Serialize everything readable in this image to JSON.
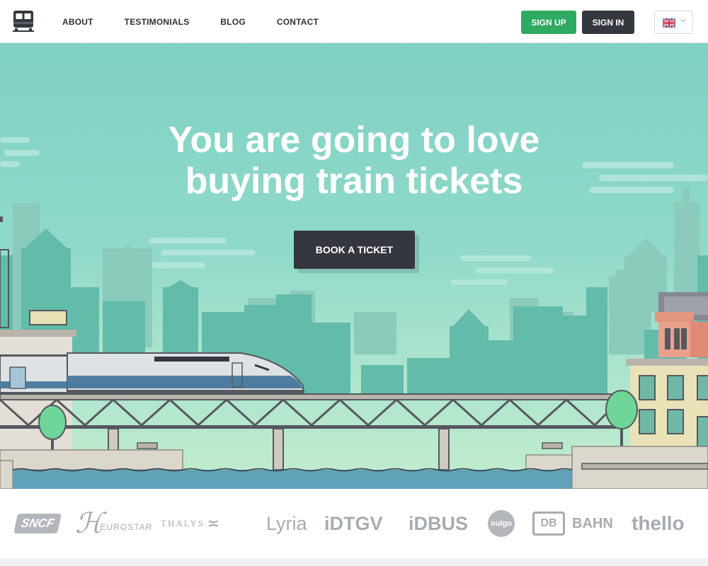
{
  "nav": {
    "links": [
      "ABOUT",
      "TESTIMONIALS",
      "BLOG",
      "CONTACT"
    ],
    "signup_label": "SIGN UP",
    "signin_label": "SIGN IN",
    "language_flag": "uk-flag-icon"
  },
  "hero": {
    "title_line1": "You are going to love",
    "title_line2": "buying train tickets",
    "cta_label": "BOOK A TICKET"
  },
  "partners": [
    "SNCF",
    "EUROSTAR",
    "THALYS",
    "Lyria",
    "iDTGV",
    "iDBUS",
    "ouigo",
    "DB",
    "BAHN",
    "thello"
  ],
  "colors": {
    "accent_green": "#2eaa62",
    "dark": "#35373f",
    "sky": "#7fd1c4",
    "partner_gray": "#a7acb1"
  }
}
